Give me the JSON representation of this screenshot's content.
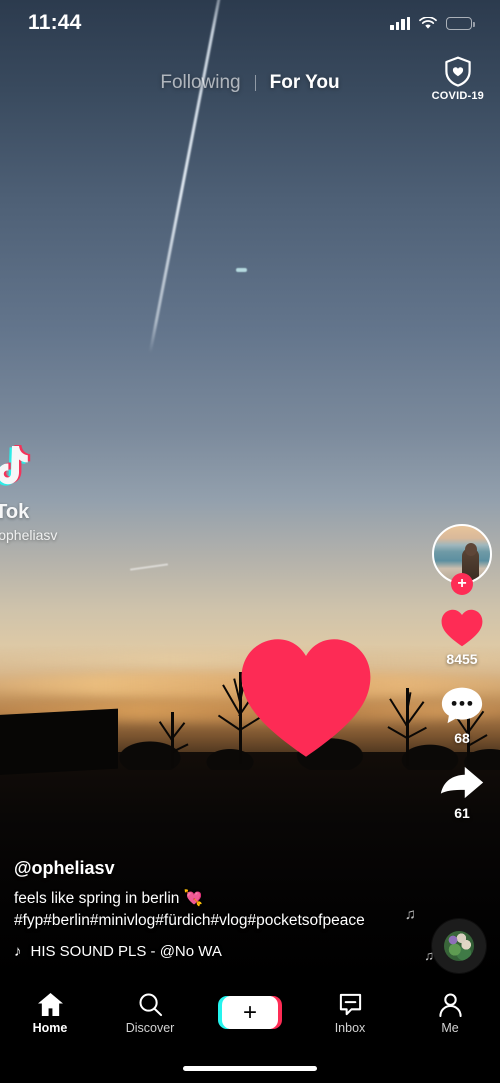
{
  "status_bar": {
    "time": "11:44",
    "signal_icon": "cellular-bars-icon",
    "wifi_icon": "wifi-icon",
    "battery_icon": "battery-low-icon",
    "battery_level_percent": 28,
    "battery_color": "#f5c518"
  },
  "top_bar": {
    "tabs": [
      {
        "label": "Following",
        "active": false
      },
      {
        "label": "For You",
        "active": true
      }
    ],
    "covid_button": {
      "label": "COVID-19",
      "icon": "shield-heart-icon"
    }
  },
  "watermark": {
    "logo_icon": "tiktok-logo-icon",
    "brand": "kTok",
    "username": "@opheliasv"
  },
  "like_animation": {
    "icon": "big-heart-icon",
    "color": "#fe2c55"
  },
  "action_rail": {
    "avatar": {
      "name": "creator-avatar",
      "follow_label": "+",
      "follow_color": "#fe2c55"
    },
    "actions": [
      {
        "name": "like",
        "icon": "heart-icon",
        "count": "8455",
        "active": true,
        "color": "#fe2c55"
      },
      {
        "name": "comment",
        "icon": "comment-icon",
        "count": "68",
        "active": false,
        "color": "#ffffff"
      },
      {
        "name": "share",
        "icon": "share-arrow-icon",
        "count": "61",
        "active": false,
        "color": "#ffffff"
      }
    ]
  },
  "caption": {
    "username": "@opheliasv",
    "text": "feels like spring in berlin 💘",
    "hashtags": "#fyp#berlin#minivlog#fürdich#vlog#pocketsofpeace",
    "sound_icon": "music-note-icon",
    "sound_title": "HIS SOUND PLS - @No    WA"
  },
  "music_disc": {
    "name": "spinning-record",
    "note_icons": [
      "music-note-icon",
      "music-note-icon"
    ]
  },
  "bottom_nav": {
    "items": [
      {
        "label": "Home",
        "icon": "home-icon",
        "active": true
      },
      {
        "label": "Discover",
        "icon": "search-icon",
        "active": false
      },
      {
        "label": "Inbox",
        "icon": "inbox-icon",
        "active": false
      },
      {
        "label": "Me",
        "icon": "person-icon",
        "active": false
      }
    ],
    "create_button": {
      "label": "+",
      "left_color": "#25f4ee",
      "right_color": "#fe2c55"
    }
  }
}
